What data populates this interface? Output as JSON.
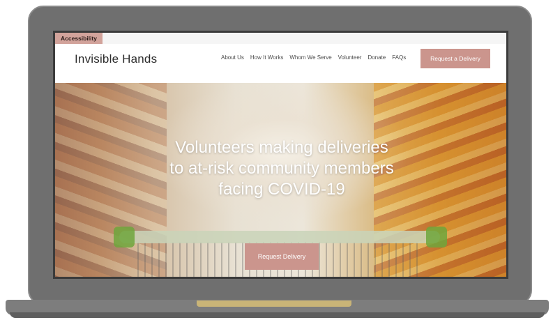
{
  "site": {
    "accessibility_label": "Accessibility",
    "brand": "Invisible Hands"
  },
  "nav": {
    "items": [
      {
        "label": "About Us"
      },
      {
        "label": "How It Works"
      },
      {
        "label": "Whom We Serve"
      },
      {
        "label": "Volunteer"
      },
      {
        "label": "Donate"
      },
      {
        "label": "FAQs"
      }
    ],
    "cta_label": "Request a Delivery"
  },
  "hero": {
    "heading": "Volunteers making deliveries to at-risk community members facing COVID-19",
    "cta_label": "Request Delivery"
  },
  "colors": {
    "accent": "#cb958d",
    "accessibility_tab": "#d2a39b",
    "laptop_frame": "#6f6f6f",
    "hinge_strip": "#c9b477"
  }
}
